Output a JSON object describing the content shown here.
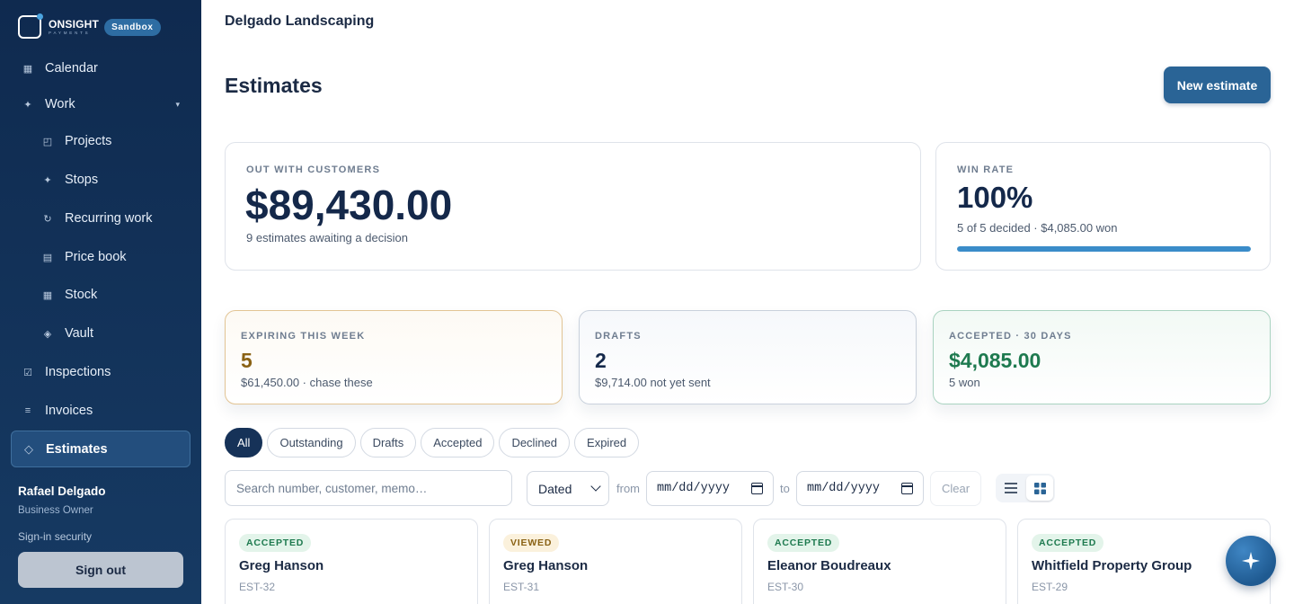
{
  "brand": {
    "name": "ONSIGHT",
    "sub": "PAYMENTS",
    "env_badge": "Sandbox"
  },
  "sidebar": {
    "items": [
      {
        "label": "Calendar",
        "icon": "calendar-icon"
      },
      {
        "label": "Work",
        "icon": "sparkle-icon",
        "expanded": true
      },
      {
        "label": "Projects",
        "icon": "projects-icon"
      },
      {
        "label": "Stops",
        "icon": "sparkle-icon"
      },
      {
        "label": "Recurring work",
        "icon": "refresh-icon"
      },
      {
        "label": "Price book",
        "icon": "book-icon"
      },
      {
        "label": "Stock",
        "icon": "grid-icon"
      },
      {
        "label": "Vault",
        "icon": "diamond-icon"
      },
      {
        "label": "Inspections",
        "icon": "checkbox-icon"
      },
      {
        "label": "Invoices",
        "icon": "list-icon"
      },
      {
        "label": "Estimates",
        "icon": "diamond-outline-icon",
        "active": true
      }
    ],
    "user": {
      "name": "Rafael Delgado",
      "role": "Business Owner"
    },
    "signin_security": "Sign-in security",
    "signout_label": "Sign out"
  },
  "header": {
    "company": "Delgado Landscaping"
  },
  "page": {
    "title": "Estimates",
    "new_button": "New estimate"
  },
  "stats": {
    "out_with_customers": {
      "label": "OUT WITH CUSTOMERS",
      "amount": "$89,430.00",
      "sub": "9 estimates awaiting a decision"
    },
    "win_rate": {
      "label": "WIN RATE",
      "value": "100%",
      "sub": "5 of 5 decided · $4,085.00 won",
      "progress": 1.0
    },
    "expiring": {
      "label": "EXPIRING THIS WEEK",
      "value": "5",
      "sub": "$61,450.00 · chase these"
    },
    "drafts": {
      "label": "DRAFTS",
      "value": "2",
      "sub": "$9,714.00 not yet sent"
    },
    "accepted": {
      "label": "ACCEPTED · 30 DAYS",
      "value": "$4,085.00",
      "sub": "5 won"
    }
  },
  "filters": {
    "chips": [
      "All",
      "Outstanding",
      "Drafts",
      "Accepted",
      "Declined",
      "Expired"
    ],
    "active_chip": "All",
    "search_placeholder": "Search number, customer, memo…",
    "date_mode": "Dated",
    "from_label": "from",
    "to_label": "to",
    "date_placeholder": "mm/dd/yyyy",
    "clear_label": "Clear",
    "view": "grid"
  },
  "estimates": [
    {
      "status": "ACCEPTED",
      "customer": "Greg Hanson",
      "number": "EST-32"
    },
    {
      "status": "VIEWED",
      "customer": "Greg Hanson",
      "number": "EST-31"
    },
    {
      "status": "ACCEPTED",
      "customer": "Eleanor Boudreaux",
      "number": "EST-30"
    },
    {
      "status": "ACCEPTED",
      "customer": "Whitfield Property Group",
      "number": "EST-29"
    }
  ],
  "colors": {
    "sidebar": "#0f2a4f",
    "accent": "#2a6496",
    "accepted": "#1e7a4f",
    "warning": "#8a6214"
  }
}
